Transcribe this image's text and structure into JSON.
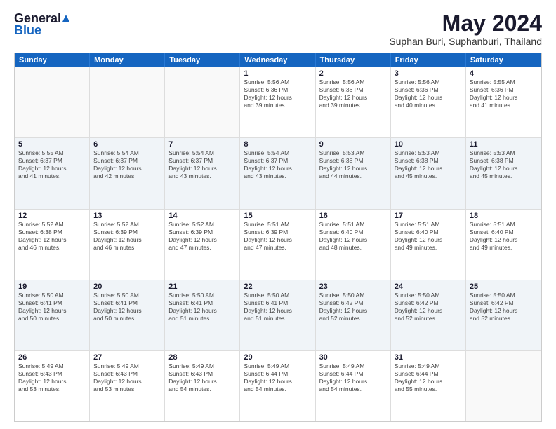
{
  "logo": {
    "general": "General",
    "blue": "Blue"
  },
  "title": "May 2024",
  "subtitle": "Suphan Buri, Suphanburi, Thailand",
  "days": [
    "Sunday",
    "Monday",
    "Tuesday",
    "Wednesday",
    "Thursday",
    "Friday",
    "Saturday"
  ],
  "weeks": [
    [
      {
        "day": "",
        "info": ""
      },
      {
        "day": "",
        "info": ""
      },
      {
        "day": "",
        "info": ""
      },
      {
        "day": "1",
        "info": "Sunrise: 5:56 AM\nSunset: 6:36 PM\nDaylight: 12 hours\nand 39 minutes."
      },
      {
        "day": "2",
        "info": "Sunrise: 5:56 AM\nSunset: 6:36 PM\nDaylight: 12 hours\nand 39 minutes."
      },
      {
        "day": "3",
        "info": "Sunrise: 5:56 AM\nSunset: 6:36 PM\nDaylight: 12 hours\nand 40 minutes."
      },
      {
        "day": "4",
        "info": "Sunrise: 5:55 AM\nSunset: 6:36 PM\nDaylight: 12 hours\nand 41 minutes."
      }
    ],
    [
      {
        "day": "5",
        "info": "Sunrise: 5:55 AM\nSunset: 6:37 PM\nDaylight: 12 hours\nand 41 minutes."
      },
      {
        "day": "6",
        "info": "Sunrise: 5:54 AM\nSunset: 6:37 PM\nDaylight: 12 hours\nand 42 minutes."
      },
      {
        "day": "7",
        "info": "Sunrise: 5:54 AM\nSunset: 6:37 PM\nDaylight: 12 hours\nand 43 minutes."
      },
      {
        "day": "8",
        "info": "Sunrise: 5:54 AM\nSunset: 6:37 PM\nDaylight: 12 hours\nand 43 minutes."
      },
      {
        "day": "9",
        "info": "Sunrise: 5:53 AM\nSunset: 6:38 PM\nDaylight: 12 hours\nand 44 minutes."
      },
      {
        "day": "10",
        "info": "Sunrise: 5:53 AM\nSunset: 6:38 PM\nDaylight: 12 hours\nand 45 minutes."
      },
      {
        "day": "11",
        "info": "Sunrise: 5:53 AM\nSunset: 6:38 PM\nDaylight: 12 hours\nand 45 minutes."
      }
    ],
    [
      {
        "day": "12",
        "info": "Sunrise: 5:52 AM\nSunset: 6:38 PM\nDaylight: 12 hours\nand 46 minutes."
      },
      {
        "day": "13",
        "info": "Sunrise: 5:52 AM\nSunset: 6:39 PM\nDaylight: 12 hours\nand 46 minutes."
      },
      {
        "day": "14",
        "info": "Sunrise: 5:52 AM\nSunset: 6:39 PM\nDaylight: 12 hours\nand 47 minutes."
      },
      {
        "day": "15",
        "info": "Sunrise: 5:51 AM\nSunset: 6:39 PM\nDaylight: 12 hours\nand 47 minutes."
      },
      {
        "day": "16",
        "info": "Sunrise: 5:51 AM\nSunset: 6:40 PM\nDaylight: 12 hours\nand 48 minutes."
      },
      {
        "day": "17",
        "info": "Sunrise: 5:51 AM\nSunset: 6:40 PM\nDaylight: 12 hours\nand 49 minutes."
      },
      {
        "day": "18",
        "info": "Sunrise: 5:51 AM\nSunset: 6:40 PM\nDaylight: 12 hours\nand 49 minutes."
      }
    ],
    [
      {
        "day": "19",
        "info": "Sunrise: 5:50 AM\nSunset: 6:41 PM\nDaylight: 12 hours\nand 50 minutes."
      },
      {
        "day": "20",
        "info": "Sunrise: 5:50 AM\nSunset: 6:41 PM\nDaylight: 12 hours\nand 50 minutes."
      },
      {
        "day": "21",
        "info": "Sunrise: 5:50 AM\nSunset: 6:41 PM\nDaylight: 12 hours\nand 51 minutes."
      },
      {
        "day": "22",
        "info": "Sunrise: 5:50 AM\nSunset: 6:41 PM\nDaylight: 12 hours\nand 51 minutes."
      },
      {
        "day": "23",
        "info": "Sunrise: 5:50 AM\nSunset: 6:42 PM\nDaylight: 12 hours\nand 52 minutes."
      },
      {
        "day": "24",
        "info": "Sunrise: 5:50 AM\nSunset: 6:42 PM\nDaylight: 12 hours\nand 52 minutes."
      },
      {
        "day": "25",
        "info": "Sunrise: 5:50 AM\nSunset: 6:42 PM\nDaylight: 12 hours\nand 52 minutes."
      }
    ],
    [
      {
        "day": "26",
        "info": "Sunrise: 5:49 AM\nSunset: 6:43 PM\nDaylight: 12 hours\nand 53 minutes."
      },
      {
        "day": "27",
        "info": "Sunrise: 5:49 AM\nSunset: 6:43 PM\nDaylight: 12 hours\nand 53 minutes."
      },
      {
        "day": "28",
        "info": "Sunrise: 5:49 AM\nSunset: 6:43 PM\nDaylight: 12 hours\nand 54 minutes."
      },
      {
        "day": "29",
        "info": "Sunrise: 5:49 AM\nSunset: 6:44 PM\nDaylight: 12 hours\nand 54 minutes."
      },
      {
        "day": "30",
        "info": "Sunrise: 5:49 AM\nSunset: 6:44 PM\nDaylight: 12 hours\nand 54 minutes."
      },
      {
        "day": "31",
        "info": "Sunrise: 5:49 AM\nSunset: 6:44 PM\nDaylight: 12 hours\nand 55 minutes."
      },
      {
        "day": "",
        "info": ""
      }
    ]
  ]
}
